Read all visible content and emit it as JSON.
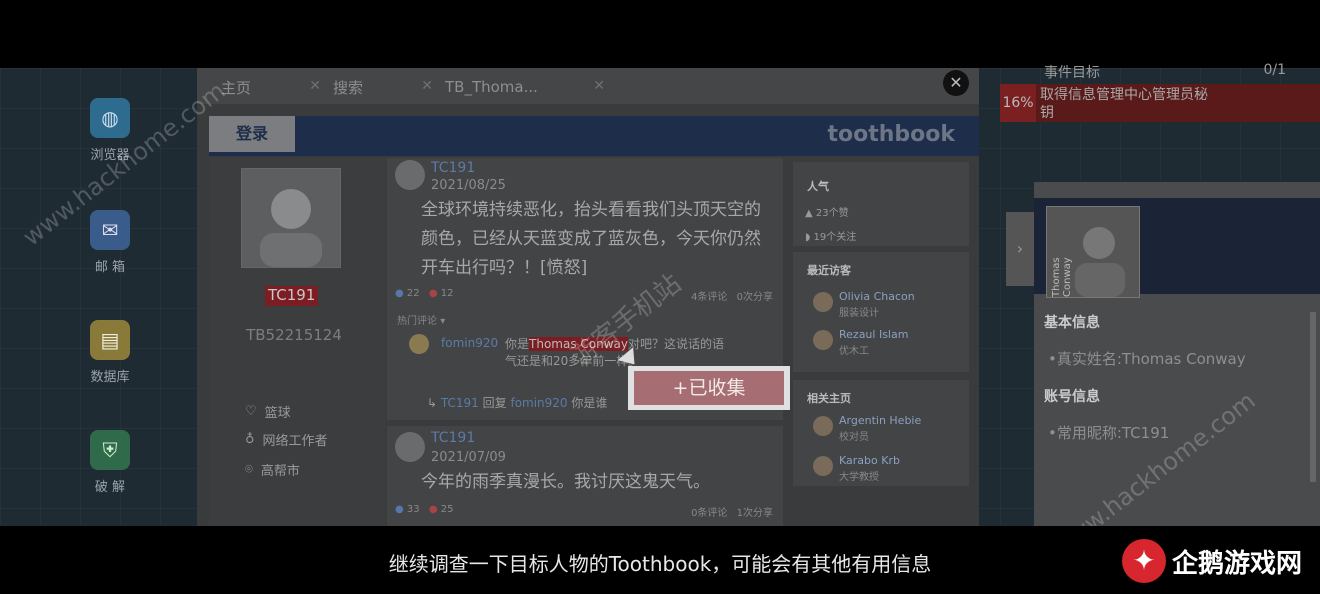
{
  "desktop": {
    "icons": [
      {
        "label": "浏览器",
        "icon": "globe-icon"
      },
      {
        "label": "邮 箱",
        "icon": "mail-icon"
      },
      {
        "label": "数据库",
        "icon": "database-icon"
      },
      {
        "label": "破 解",
        "icon": "shield-icon"
      }
    ]
  },
  "browser": {
    "tabs": [
      {
        "label": "主页"
      },
      {
        "label": "搜索"
      },
      {
        "label": "TB_Thoma..."
      }
    ],
    "close_label": "✕"
  },
  "toothbook": {
    "login_label": "登录",
    "logo": "toothbook",
    "profile": {
      "nickname": "TC191",
      "id": "TB52215124",
      "details": [
        {
          "icon": "heart-icon",
          "text": "篮球"
        },
        {
          "icon": "tie-icon",
          "text": "网络工作者"
        },
        {
          "icon": "location-icon",
          "text": "高帮市"
        }
      ]
    },
    "posts": [
      {
        "user": "TC191",
        "date": "2021/08/25",
        "text": "全球环境持续恶化，抬头看看我们头顶天空的颜色，已经从天蓝变成了蓝灰色，今天你仍然开车出行吗？！[愤怒]",
        "likes": "22",
        "hearts": "12",
        "comments": "4条评论",
        "shares": "0次分享",
        "hot_comments_label": "热门评论",
        "comment": {
          "user": "fomin920",
          "text_pre": "你是",
          "highlight": "Thomas Conway",
          "text_post": "对吧？这说话的语气还是和20多年前一样。"
        },
        "reply": {
          "user": "TC191",
          "verb": "回复",
          "target": "fomin920",
          "text": "你是谁"
        }
      },
      {
        "user": "TC191",
        "date": "2021/07/09",
        "text": "今年的雨季真漫长。我讨厌这鬼天气。",
        "likes": "33",
        "hearts": "25",
        "comments": "0条评论",
        "shares": "1次分享"
      }
    ],
    "sidebar": {
      "popularity_title": "人气",
      "likes": "23个赞",
      "follows": "19个关注",
      "visitors_title": "最近访客",
      "visitors": [
        {
          "name": "Olivia Chacon",
          "sub": "服装设计"
        },
        {
          "name": "Rezaul Islam",
          "sub": "优木工"
        }
      ],
      "related_title": "相关主页",
      "related": [
        {
          "name": "Argentin Hebie",
          "sub": "校对员"
        },
        {
          "name": "Karabo Krb",
          "sub": "大学教授"
        }
      ]
    }
  },
  "collect_button": "+已收集",
  "quest": {
    "title": "事件目标",
    "count": "0/1",
    "percent": "16%",
    "text": "取得信息管理中心管理员秘钥"
  },
  "target_panel": {
    "photo_caption": "Thomas Conway",
    "basic_label": "基本信息",
    "real_name": "•真实姓名:Thomas Conway",
    "account_label": "账号信息",
    "nickname": "•常用昵称:TC191"
  },
  "subtitle": "继续调查一下目标人物的Toothbook，可能会有其他有用信息",
  "watermarks": {
    "left": "www.hackhome.com",
    "center": "游客手机站",
    "right": "www.hackhome.com"
  },
  "brand": "企鹅游戏网",
  "colors": {
    "accent_red": "#7b1d22",
    "collect": "#a66e72",
    "header_navy": "#1d2d4a"
  }
}
